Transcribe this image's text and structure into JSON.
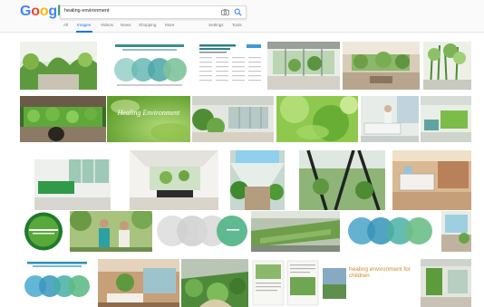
{
  "search": {
    "query": "healing environment",
    "logo_letters": [
      {
        "ch": "G",
        "color": "#4285f4"
      },
      {
        "ch": "o",
        "color": "#ea4335"
      },
      {
        "ch": "o",
        "color": "#fbbc05"
      },
      {
        "ch": "g",
        "color": "#4285f4"
      },
      {
        "ch": "l",
        "color": "#34a853"
      },
      {
        "ch": "e",
        "color": "#ea4335"
      }
    ],
    "camera_icon": "camera-icon",
    "search_icon": "search-icon"
  },
  "tabs": [
    {
      "label": "All",
      "active": false
    },
    {
      "label": "Images",
      "active": true
    },
    {
      "label": "Videos",
      "active": false
    },
    {
      "label": "News",
      "active": false
    },
    {
      "label": "Shopping",
      "active": false
    },
    {
      "label": "More",
      "active": false
    },
    {
      "label": "Settings",
      "active": false
    },
    {
      "label": "Tools",
      "active": false
    }
  ],
  "image_results": {
    "row1": [
      {
        "kind": "atrium-plants"
      },
      {
        "kind": "venn-diagram"
      },
      {
        "kind": "text-table"
      },
      {
        "kind": "glass-hall"
      },
      {
        "kind": "plant-interior"
      },
      {
        "kind": "bamboo-lobby"
      }
    ],
    "row2": [
      {
        "kind": "green-wall-room"
      },
      {
        "kind": "healing-leaves",
        "overlay": "Healing Environment"
      },
      {
        "kind": "lobby-greenery"
      },
      {
        "kind": "green-bokeh"
      },
      {
        "kind": "hospital-bed"
      },
      {
        "kind": "green-ward"
      }
    ],
    "row3": [
      {
        "kind": "reception-desk"
      },
      {
        "kind": "modern-lobby"
      },
      {
        "kind": "skylight-corridor"
      },
      {
        "kind": "steel-frame-garden"
      },
      {
        "kind": "patient-room"
      }
    ],
    "row4": [
      {
        "kind": "green-logo"
      },
      {
        "kind": "nurse-patient"
      },
      {
        "kind": "grey-venn"
      },
      {
        "kind": "roof-garden"
      },
      {
        "kind": "blue-venn"
      },
      {
        "kind": "window-room"
      }
    ],
    "row5": [
      {
        "kind": "blue-venn-small"
      },
      {
        "kind": "wood-room"
      },
      {
        "kind": "garden-aerial"
      },
      {
        "kind": "magazine"
      },
      {
        "kind": "lakeside",
        "overlay": "healing environment for children"
      },
      {
        "kind": "green-corridor"
      }
    ]
  }
}
